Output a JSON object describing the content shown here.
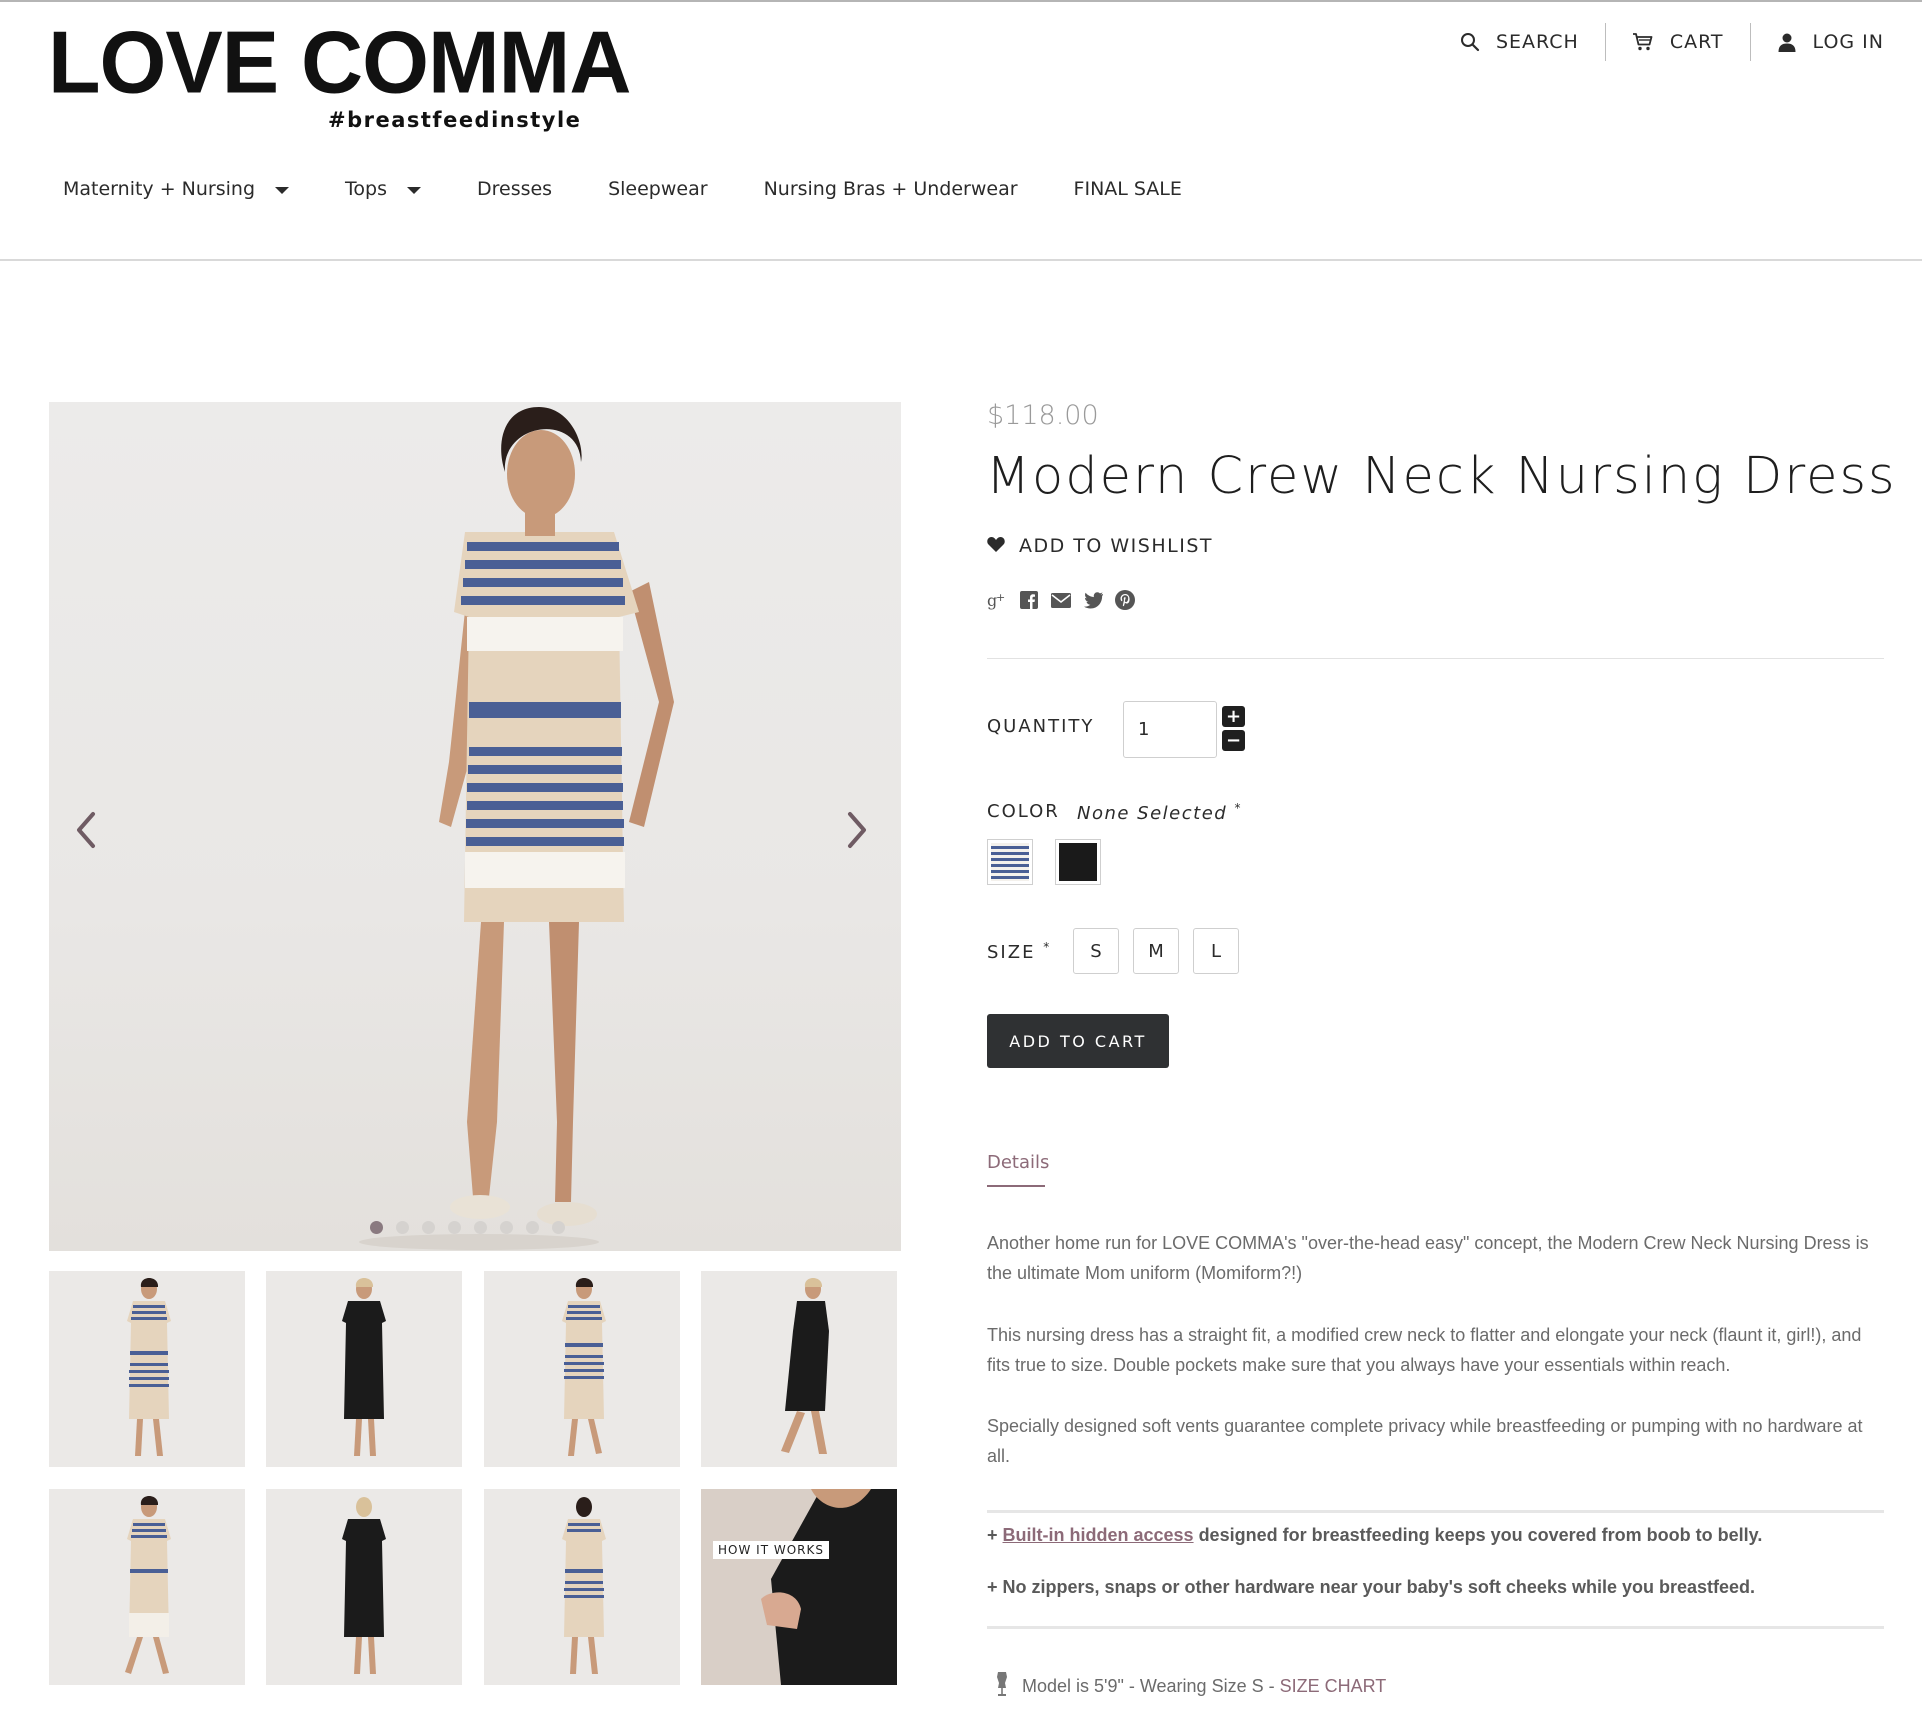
{
  "brand": {
    "name": "LOVE COMMA",
    "tagline": "#breastfeedinstyle"
  },
  "utility_nav": {
    "search": "SEARCH",
    "cart": "CART",
    "login": "LOG IN"
  },
  "main_nav": {
    "items": [
      {
        "label": "Maternity + Nursing",
        "has_dropdown": true
      },
      {
        "label": "Tops",
        "has_dropdown": true
      },
      {
        "label": "Dresses",
        "has_dropdown": false
      },
      {
        "label": "Sleepwear",
        "has_dropdown": false
      },
      {
        "label": "Nursing Bras + Underwear",
        "has_dropdown": false
      },
      {
        "label": "FINAL SALE",
        "has_dropdown": false
      }
    ]
  },
  "gallery": {
    "slide_count": 8,
    "active_slide": 1,
    "how_it_works_label": "HOW IT WORKS"
  },
  "product": {
    "price": "$118.00",
    "title": "Modern Crew Neck Nursing Dress",
    "wishlist_label": "ADD TO WISHLIST",
    "social_icons": [
      "google-plus-icon",
      "facebook-icon",
      "email-icon",
      "twitter-icon",
      "pinterest-icon"
    ],
    "quantity": {
      "label": "QUANTITY",
      "value": "1",
      "plus": "+",
      "minus": "−"
    },
    "color": {
      "label": "COLOR",
      "state": "None Selected",
      "required_mark": "*",
      "swatches": [
        "stripe",
        "black"
      ]
    },
    "size": {
      "label": "SIZE",
      "required_mark": "*",
      "options": [
        "S",
        "M",
        "L"
      ]
    },
    "add_to_cart": "ADD TO CART"
  },
  "details": {
    "tab_label": "Details",
    "paragraphs": [
      "Another home run for LOVE COMMA's \"over-the-head easy\" concept, the Modern Crew Neck Nursing Dress is the ultimate Mom uniform (Momiform?!)",
      "This nursing dress has a straight fit, a modified crew neck to flatter and elongate your neck (flaunt it, girl!), and fits true to size. Double pockets make sure that you always have your essentials within reach.",
      "Specially designed soft vents guarantee complete privacy while breastfeeding or pumping with no hardware at all."
    ],
    "feature1": {
      "prefix": "+ ",
      "link": "Built-in hidden access",
      "rest": " designed for breastfeeding keeps you covered from boob to belly."
    },
    "feature2": "+ No zippers, snaps or other hardware near your baby's soft cheeks while you breastfeed.",
    "model_note": "Model is 5'9\" - Wearing Size S - ",
    "size_chart_link": "SIZE CHART"
  },
  "colors": {
    "accent": "#8c6a78",
    "button_dark": "#2f3133",
    "stripe_blue": "#4a5f95",
    "beige": "#e3d3bd"
  }
}
